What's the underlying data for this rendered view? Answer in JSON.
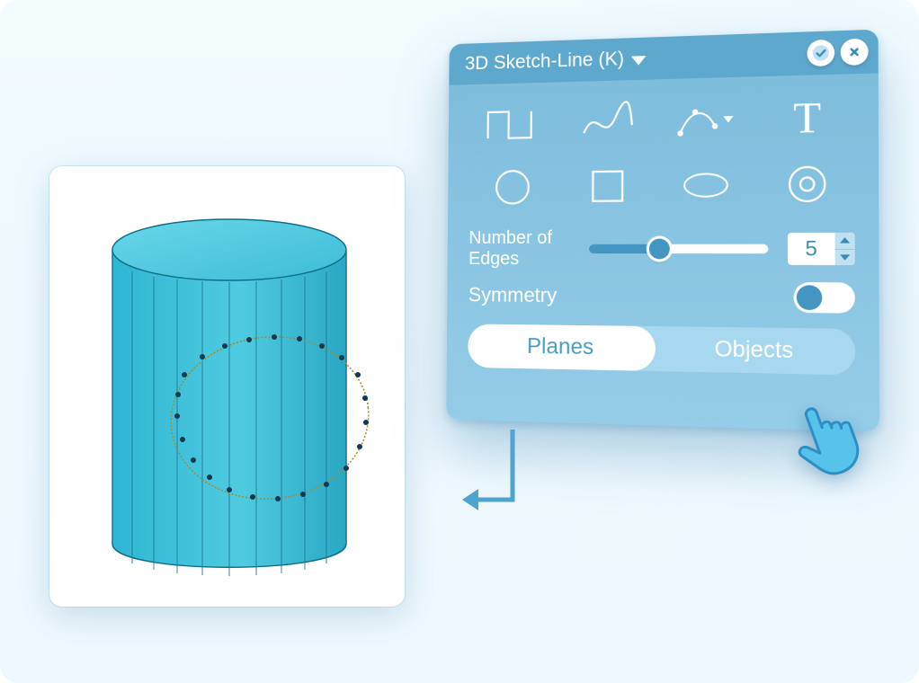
{
  "panel": {
    "title": "3D Sketch-Line (K)",
    "confirm_icon": "check-icon",
    "close_icon": "close-icon",
    "tools": [
      {
        "name": "polyline-icon"
      },
      {
        "name": "curve-icon"
      },
      {
        "name": "bezier-icon"
      },
      {
        "name": "text-icon"
      },
      {
        "name": "circle-icon"
      },
      {
        "name": "square-icon"
      },
      {
        "name": "ellipse-icon"
      },
      {
        "name": "ring-icon"
      }
    ],
    "edges": {
      "label": "Number of Edges",
      "value": "5"
    },
    "symmetry": {
      "label": "Symmetry",
      "on": true
    },
    "segmented": {
      "planes": "Planes",
      "objects": "Objects",
      "active": "planes"
    }
  }
}
